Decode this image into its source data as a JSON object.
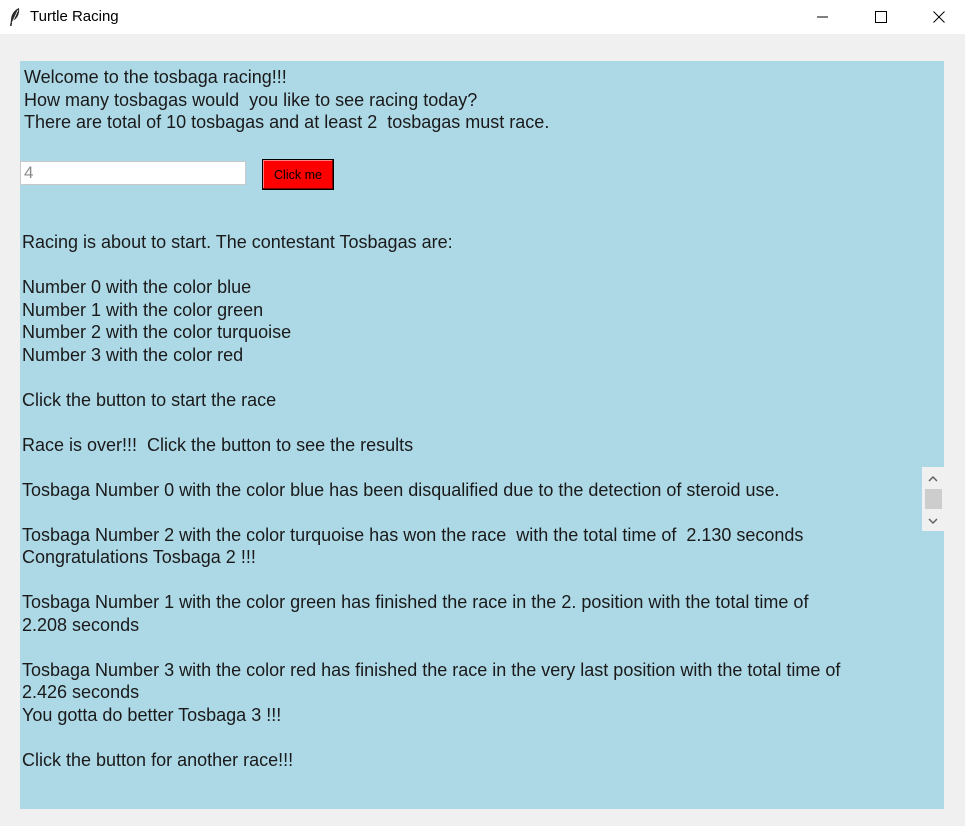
{
  "window": {
    "title": "Turtle Racing",
    "icons": {
      "app": "feather-icon",
      "minimize": "minimize-icon",
      "maximize": "maximize-icon",
      "close": "close-icon"
    }
  },
  "intro": {
    "text": "Welcome to the tosbaga racing!!!\nHow many tosbagas would  you like to see racing today?\nThere are total of 10 tosbagas and at least 2  tosbagas must race."
  },
  "form": {
    "input_value": "4",
    "button_label": "Click me",
    "button_color": "#ff0000"
  },
  "results": {
    "text": "Racing is about to start. The contestant Tosbagas are:\n\nNumber 0 with the color blue\nNumber 1 with the color green\nNumber 2 with the color turquoise\nNumber 3 with the color red\n\nClick the button to start the race\n\nRace is over!!!  Click the button to see the results\n\nTosbaga Number 0 with the color blue has been disqualified due to the detection of steroid use.\n\nTosbaga Number 2 with the color turquoise has won the race  with the total time of  2.130 seconds\nCongratulations Tosbaga 2 !!!\n\nTosbaga Number 1 with the color green has finished the race in the 2. position with the total time of\n2.208 seconds\n\nTosbaga Number 3 with the color red has finished the race in the very last position with the total time of\n2.426 seconds\nYou gotta do better Tosbaga 3 !!!\n\nClick the button for another race!!!"
  },
  "colors": {
    "content_background": "#add8e6",
    "window_background": "#f0f0f0"
  },
  "scrollbar": {
    "up_icon": "chevron-up-icon",
    "down_icon": "chevron-down-icon"
  }
}
